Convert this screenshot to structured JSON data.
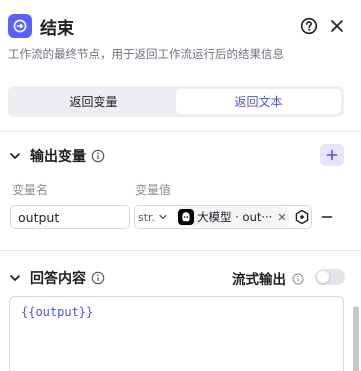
{
  "header": {
    "title": "结束",
    "icon": "end-node-icon",
    "accent": "#5b61ff",
    "description": "工作流的最终节点，用于返回工作流运行后的结果信息"
  },
  "mode_tabs": [
    {
      "label": "返回变量",
      "active": false
    },
    {
      "label": "返回文本",
      "active": true
    }
  ],
  "output_section": {
    "title": "输出变量",
    "columns": {
      "name": "变量名",
      "value": "变量值"
    },
    "rows": [
      {
        "name": "output",
        "type": "str.",
        "reference": "大模型 · out···",
        "reference_icon": "llm-node-icon"
      }
    ]
  },
  "answer_section": {
    "title": "回答内容",
    "stream_label": "流式输出",
    "stream_enabled": false,
    "content": "{{output}}"
  }
}
